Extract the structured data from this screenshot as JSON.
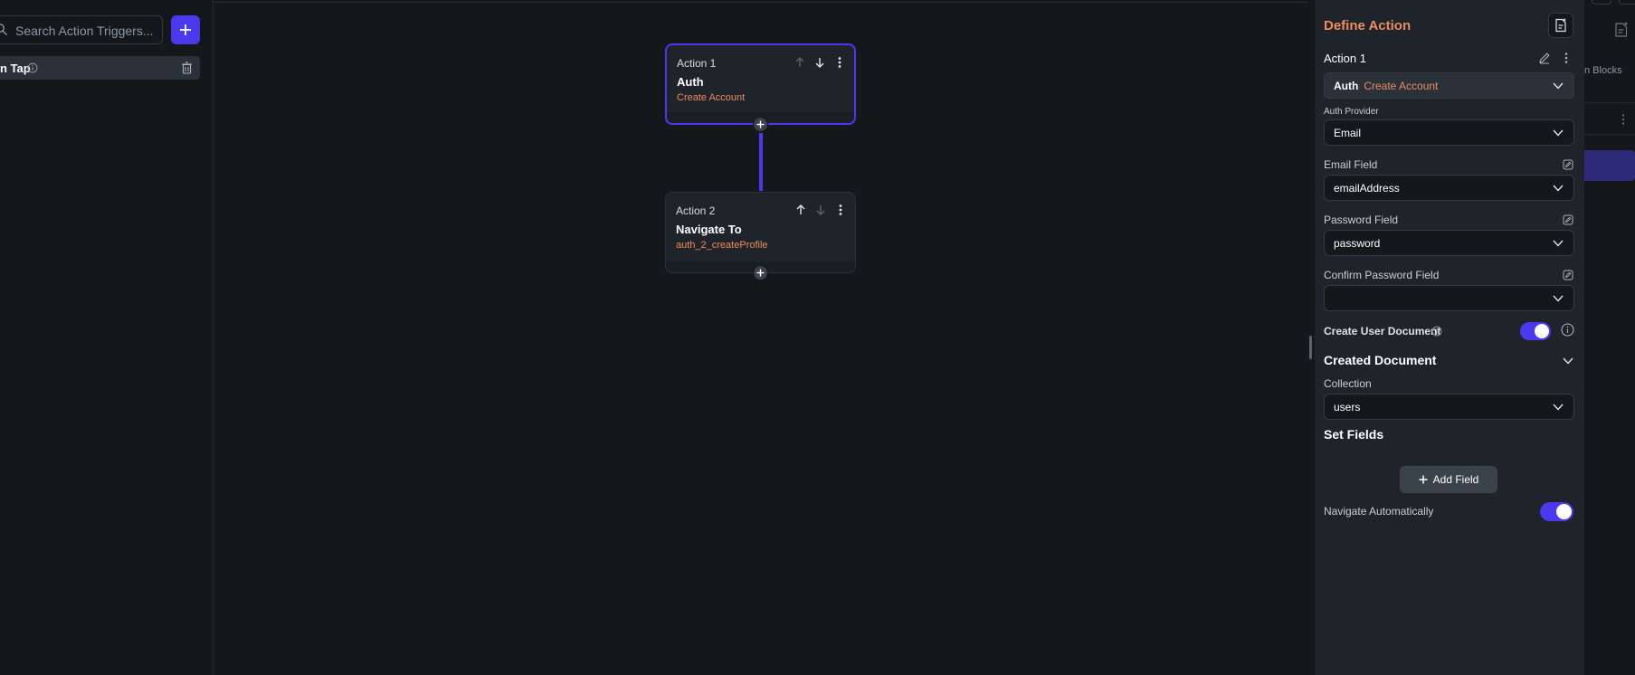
{
  "left_panel": {
    "search_placeholder": "Search Action Triggers...",
    "add_label": "+",
    "trigger_label": "n Tap"
  },
  "canvas": {
    "nodes": [
      {
        "title": "Action 1",
        "name": "Auth",
        "subtitle": "Create Account"
      },
      {
        "title": "Action 2",
        "name": "Navigate To",
        "subtitle": "auth_2_createProfile"
      }
    ]
  },
  "define_action": {
    "title": "Define Action",
    "action_label": "Action 1",
    "action_select": {
      "category": "Auth",
      "action": "Create Account"
    },
    "auth_provider": {
      "label": "Auth Provider",
      "value": "Email"
    },
    "email_field": {
      "label": "Email Field",
      "value": "emailAddress"
    },
    "password_field": {
      "label": "Password Field",
      "value": "password"
    },
    "confirm_password_field": {
      "label": "Confirm Password Field",
      "value": ""
    },
    "create_user_document": {
      "label": "Create User Document",
      "enabled": true
    },
    "created_document": {
      "title": "Created Document"
    },
    "collection": {
      "label": "Collection",
      "value": "users"
    },
    "set_fields": {
      "title": "Set Fields",
      "add_button": "Add Field"
    },
    "navigate_automatically": {
      "label": "Navigate Automatically",
      "enabled": true
    }
  },
  "far_right": {
    "text": "n Blocks"
  },
  "colors": {
    "accent": "#4b39ef",
    "orange": "#ee8b60",
    "background": "#14181b",
    "panel": "#1e2429"
  }
}
